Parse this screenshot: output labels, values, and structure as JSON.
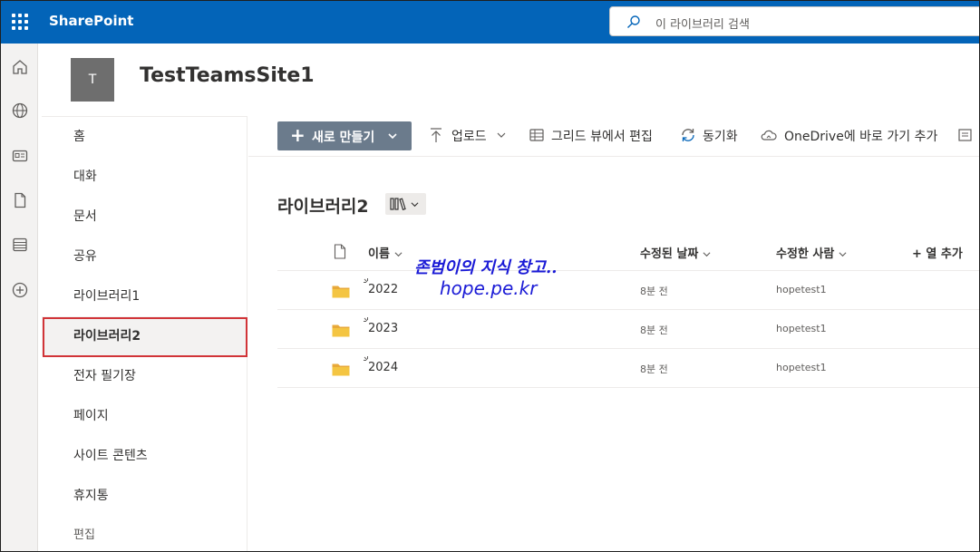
{
  "topbar": {
    "brand": "SharePoint",
    "search_placeholder": "이 라이브러리 검색"
  },
  "site": {
    "logo_letter": "T",
    "title": "TestTeamsSite1"
  },
  "nav": {
    "items": [
      {
        "label": "홈"
      },
      {
        "label": "대화"
      },
      {
        "label": "문서"
      },
      {
        "label": "공유"
      },
      {
        "label": "라이브러리1"
      },
      {
        "label": "라이브러리2"
      },
      {
        "label": "전자 필기장"
      },
      {
        "label": "페이지"
      },
      {
        "label": "사이트 콘텐츠"
      },
      {
        "label": "휴지통"
      },
      {
        "label": "편집"
      }
    ],
    "selected_index": 5
  },
  "command_bar": {
    "new_label": "새로 만들기",
    "upload_label": "업로드",
    "grid_edit_label": "그리드 뷰에서 편집",
    "sync_label": "동기화",
    "onedrive_label": "OneDrive에 바로 가기 추가"
  },
  "library": {
    "title": "라이브러리2"
  },
  "list": {
    "columns": {
      "name": "이름",
      "modified": "수정된 날짜",
      "modified_by": "수정한 사람",
      "add_column": "+ 열 추가"
    },
    "rows": [
      {
        "name": "2022",
        "modified": "8분 전",
        "modified_by": "hopetest1"
      },
      {
        "name": "2023",
        "modified": "8분 전",
        "modified_by": "hopetest1"
      },
      {
        "name": "2024",
        "modified": "8분 전",
        "modified_by": "hopetest1"
      }
    ]
  },
  "watermark": {
    "line1": "존범이의 지식 창고..",
    "line2": "hope.pe.kr"
  },
  "colors": {
    "suite_bar": "#0364b8",
    "new_button": "#6b7b8c",
    "selection_outline": "#d13438",
    "watermark": "#1a1ad6",
    "folder": "#f4c542"
  }
}
